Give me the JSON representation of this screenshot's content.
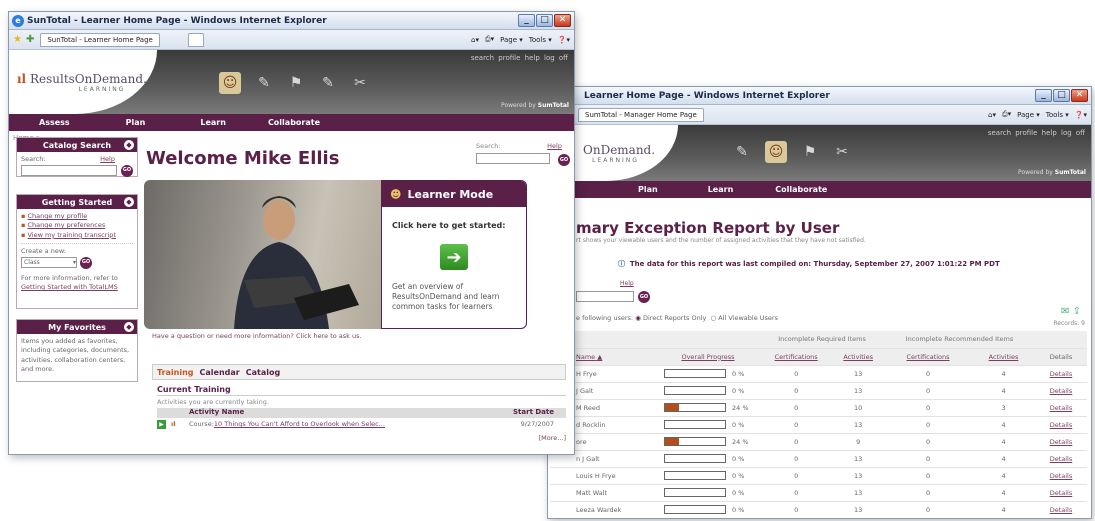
{
  "colors": {
    "brand": "#5a2048",
    "accent": "#c4551f",
    "progress": "#b2501c"
  },
  "win1": {
    "title": "SunTotal - Learner Home Page - Windows Internet Explorer",
    "tab": "SunTotal - Learner Home Page",
    "toolbar_tools": [
      "Page ▾",
      "Tools ▾"
    ],
    "logo": {
      "bars": "ıl",
      "text": "ResultsOnDemand.",
      "sub": "LEARNING"
    },
    "toplinks": "search profile help log off",
    "powered": "Powered by",
    "powered_brand": "SumTotal",
    "nav": [
      "Assess",
      "Plan",
      "Learn",
      "Collaborate"
    ],
    "breadcrumb": "Home >",
    "catalog": {
      "title": "Catalog Search",
      "search_label": "Search:",
      "help": "Help",
      "go": "GO"
    },
    "getting_started": {
      "title": "Getting Started",
      "links": [
        "Change my profile",
        "Change my preferences",
        "View my training transcript"
      ],
      "create_label": "Create a new:",
      "select_value": "Class",
      "info_prefix": "For more information, refer to",
      "info_link": "Getting Started with TotalLMS"
    },
    "favorites": {
      "title": "My Favorites",
      "text": "Items you added as favorites, including categories, documents, activities, collaboration centers, and more."
    },
    "welcome": "Welcome Mike Ellis",
    "search": {
      "label": "Search:",
      "help": "Help",
      "go": "GO"
    },
    "learner_mode": {
      "title": "Learner Mode",
      "cta": "Click here to get started:",
      "desc": "Get an overview of ResultsOnDemand and learn common tasks for learners"
    },
    "question_text": "Have a question or need more information? Click here to ask us.",
    "tabs": [
      "Training",
      "Calendar",
      "Catalog"
    ],
    "current_training": {
      "title": "Current Training",
      "subtitle": "Activities you are currently taking.",
      "headers": [
        "Activity Name",
        "Start Date"
      ],
      "row": {
        "prefix": "Course:",
        "name": "10 Things You Can't Afford to Overlook when Selec...",
        "date": "9/27/2007"
      },
      "more": "[More...]"
    }
  },
  "win2": {
    "title": "Learner Home Page - Windows Internet Explorer",
    "tab": "SumTotal - Manager Home Page",
    "toolbar_tools": [
      "Page ▾",
      "Tools ▾"
    ],
    "logo": {
      "text": "OnDemand.",
      "sub": "LEARNING"
    },
    "toplinks": "search profile help log off",
    "powered": "Powered by",
    "powered_brand": "SumTotal",
    "nav": [
      "Plan",
      "Learn",
      "Collaborate"
    ],
    "report_title": "mary Exception Report by User",
    "report_desc": "rt shows your viewable users and the number of assigned activities that they have not satisfied.",
    "compiled_notice": "The data for this report was last compiled on: Thursday, September 27, 2007 1:01:22 PM PDT",
    "help": "Help",
    "go": "GO",
    "filter": {
      "prefix": "e following users:",
      "opt1": "Direct Reports Only",
      "opt2": "All Viewable Users"
    },
    "records": "Records: 9",
    "group_headers": [
      "Incomplete Required Items",
      "Incomplete Recommended Items"
    ],
    "headers": [
      "Name",
      "Overall Progress",
      "Certifications",
      "Activities",
      "Certifications",
      "Activities",
      "Details"
    ],
    "rows": [
      {
        "name": "H Frye",
        "progress": 0,
        "pct": "0 %",
        "c1": "0",
        "a1": "13",
        "c2": "0",
        "a2": "4",
        "details": "Details"
      },
      {
        "name": "J Galt",
        "progress": 0,
        "pct": "0 %",
        "c1": "0",
        "a1": "13",
        "c2": "0",
        "a2": "4",
        "details": "Details"
      },
      {
        "name": "M Reed",
        "progress": 24,
        "pct": "24 %",
        "c1": "0",
        "a1": "10",
        "c2": "0",
        "a2": "3",
        "details": "Details"
      },
      {
        "name": "d Rocklin",
        "progress": 0,
        "pct": "0 %",
        "c1": "0",
        "a1": "13",
        "c2": "0",
        "a2": "4",
        "details": "Details"
      },
      {
        "name": "ore",
        "progress": 24,
        "pct": "24 %",
        "c1": "0",
        "a1": "9",
        "c2": "0",
        "a2": "4",
        "details": "Details"
      },
      {
        "name": "n J Galt",
        "progress": 0,
        "pct": "0 %",
        "c1": "0",
        "a1": "13",
        "c2": "0",
        "a2": "4",
        "details": "Details"
      },
      {
        "name": "Louis H Frye",
        "progress": 0,
        "pct": "0 %",
        "c1": "0",
        "a1": "13",
        "c2": "0",
        "a2": "4",
        "details": "Details"
      },
      {
        "name": "Matt Walt",
        "progress": 0,
        "pct": "0 %",
        "c1": "0",
        "a1": "13",
        "c2": "0",
        "a2": "4",
        "details": "Details"
      },
      {
        "name": "Leeza Wardek",
        "progress": 0,
        "pct": "0 %",
        "c1": "0",
        "a1": "13",
        "c2": "0",
        "a2": "4",
        "details": "Details"
      }
    ]
  }
}
